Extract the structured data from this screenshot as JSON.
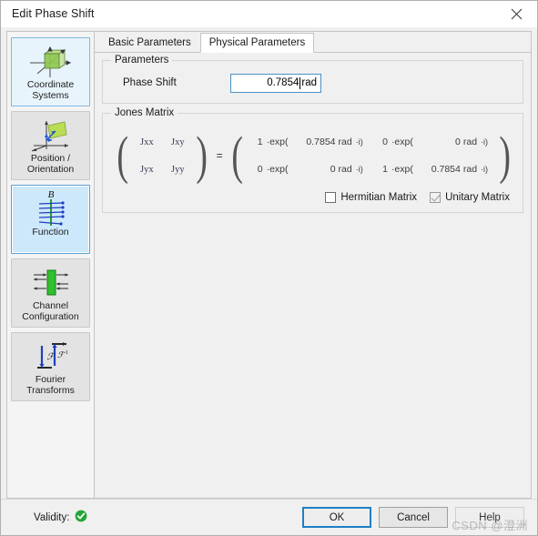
{
  "window": {
    "title": "Edit Phase Shift",
    "close_icon": "close-icon"
  },
  "sidebar": {
    "items": [
      {
        "label": "Coordinate\nSystems",
        "icon": "coordinate-systems-icon",
        "state": "highlighted"
      },
      {
        "label": "Position /\nOrientation",
        "icon": "position-orientation-icon",
        "state": "normal"
      },
      {
        "label": "Function",
        "icon": "function-icon",
        "state": "selected"
      },
      {
        "label": "Channel\nConfiguration",
        "icon": "channel-configuration-icon",
        "state": "normal"
      },
      {
        "label": "Fourier\nTransforms",
        "icon": "fourier-transforms-icon",
        "state": "normal"
      }
    ]
  },
  "tabs": [
    {
      "label": "Basic Parameters",
      "active": false
    },
    {
      "label": "Physical Parameters",
      "active": true
    }
  ],
  "parameters": {
    "group_title": "Parameters",
    "phase_shift": {
      "label": "Phase Shift",
      "value": "0.7854",
      "unit": "rad"
    }
  },
  "jones_matrix": {
    "group_title": "Jones Matrix",
    "labels": [
      "Jxx",
      "Jxy",
      "Jyx",
      "Jyy"
    ],
    "equals": "=",
    "cells": [
      {
        "coef": "1",
        "exp": "·exp(",
        "angle": "0.7854",
        "rad": "rad",
        "i": "·i)"
      },
      {
        "coef": "0",
        "exp": "·exp(",
        "angle": "0",
        "rad": "rad",
        "i": "·i)"
      },
      {
        "coef": "0",
        "exp": "·exp(",
        "angle": "0",
        "rad": "rad",
        "i": "·i)"
      },
      {
        "coef": "1",
        "exp": "·exp(",
        "angle": "0.7854",
        "rad": "rad",
        "i": "·i)"
      }
    ],
    "checkboxes": [
      {
        "label": "Hermitian Matrix",
        "checked": false,
        "disabled": false
      },
      {
        "label": "Unitary Matrix",
        "checked": true,
        "disabled": true
      }
    ]
  },
  "footer": {
    "validity_label": "Validity:",
    "validity_icon": "valid-check-icon",
    "buttons": [
      {
        "label": "OK",
        "primary": true
      },
      {
        "label": "Cancel",
        "primary": false
      },
      {
        "label": "Help",
        "primary": false
      }
    ],
    "watermark": "CSDN @澄洲"
  },
  "colors": {
    "accent": "#1f7fc4",
    "selected_nav": "#cde8fa",
    "valid_green": "#22a638",
    "dialog_bg": "#f0f0f0"
  }
}
